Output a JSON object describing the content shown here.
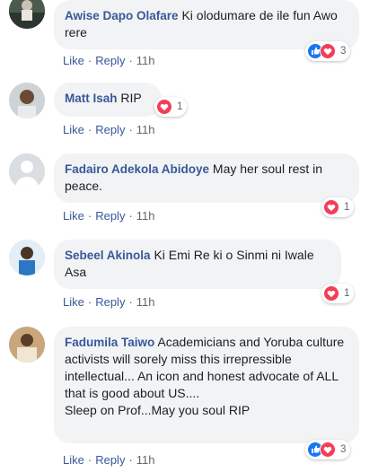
{
  "actions": {
    "like": "Like",
    "reply": "Reply",
    "separator": "·"
  },
  "comments": [
    {
      "author": "Awise Dapo Olafare",
      "text": "Ki olodumare de ile fun Awo rere",
      "time": "11h",
      "reactions": [
        "like",
        "love"
      ],
      "count": "3"
    },
    {
      "author": "Matt Isah",
      "text": "RIP",
      "time": "11h",
      "reactions": [
        "love"
      ],
      "count": "1"
    },
    {
      "author": "Fadairo Adekola Abidoye",
      "text": "May her soul rest in peace.",
      "time": "11h",
      "reactions": [
        "love"
      ],
      "count": "1"
    },
    {
      "author": "Sebeel Akinola",
      "text": "Ki Emi Re ki o Sinmi ni Iwale Asa",
      "time": "11h",
      "reactions": [
        "love"
      ],
      "count": "1"
    },
    {
      "author": "Fadumila Taiwo",
      "text": "Academicians and Yoruba culture activists will sorely miss this irrepressible intellectual... An icon and honest advocate of ALL that is good about US....",
      "text2": "Sleep on Prof...May you soul RIP",
      "time": "11h",
      "reactions": [
        "like",
        "love"
      ],
      "count": "3"
    }
  ],
  "colors": {
    "link": "#385898",
    "bubble": "#f2f3f5",
    "like": "#1877f2",
    "love": "#f33e58"
  }
}
